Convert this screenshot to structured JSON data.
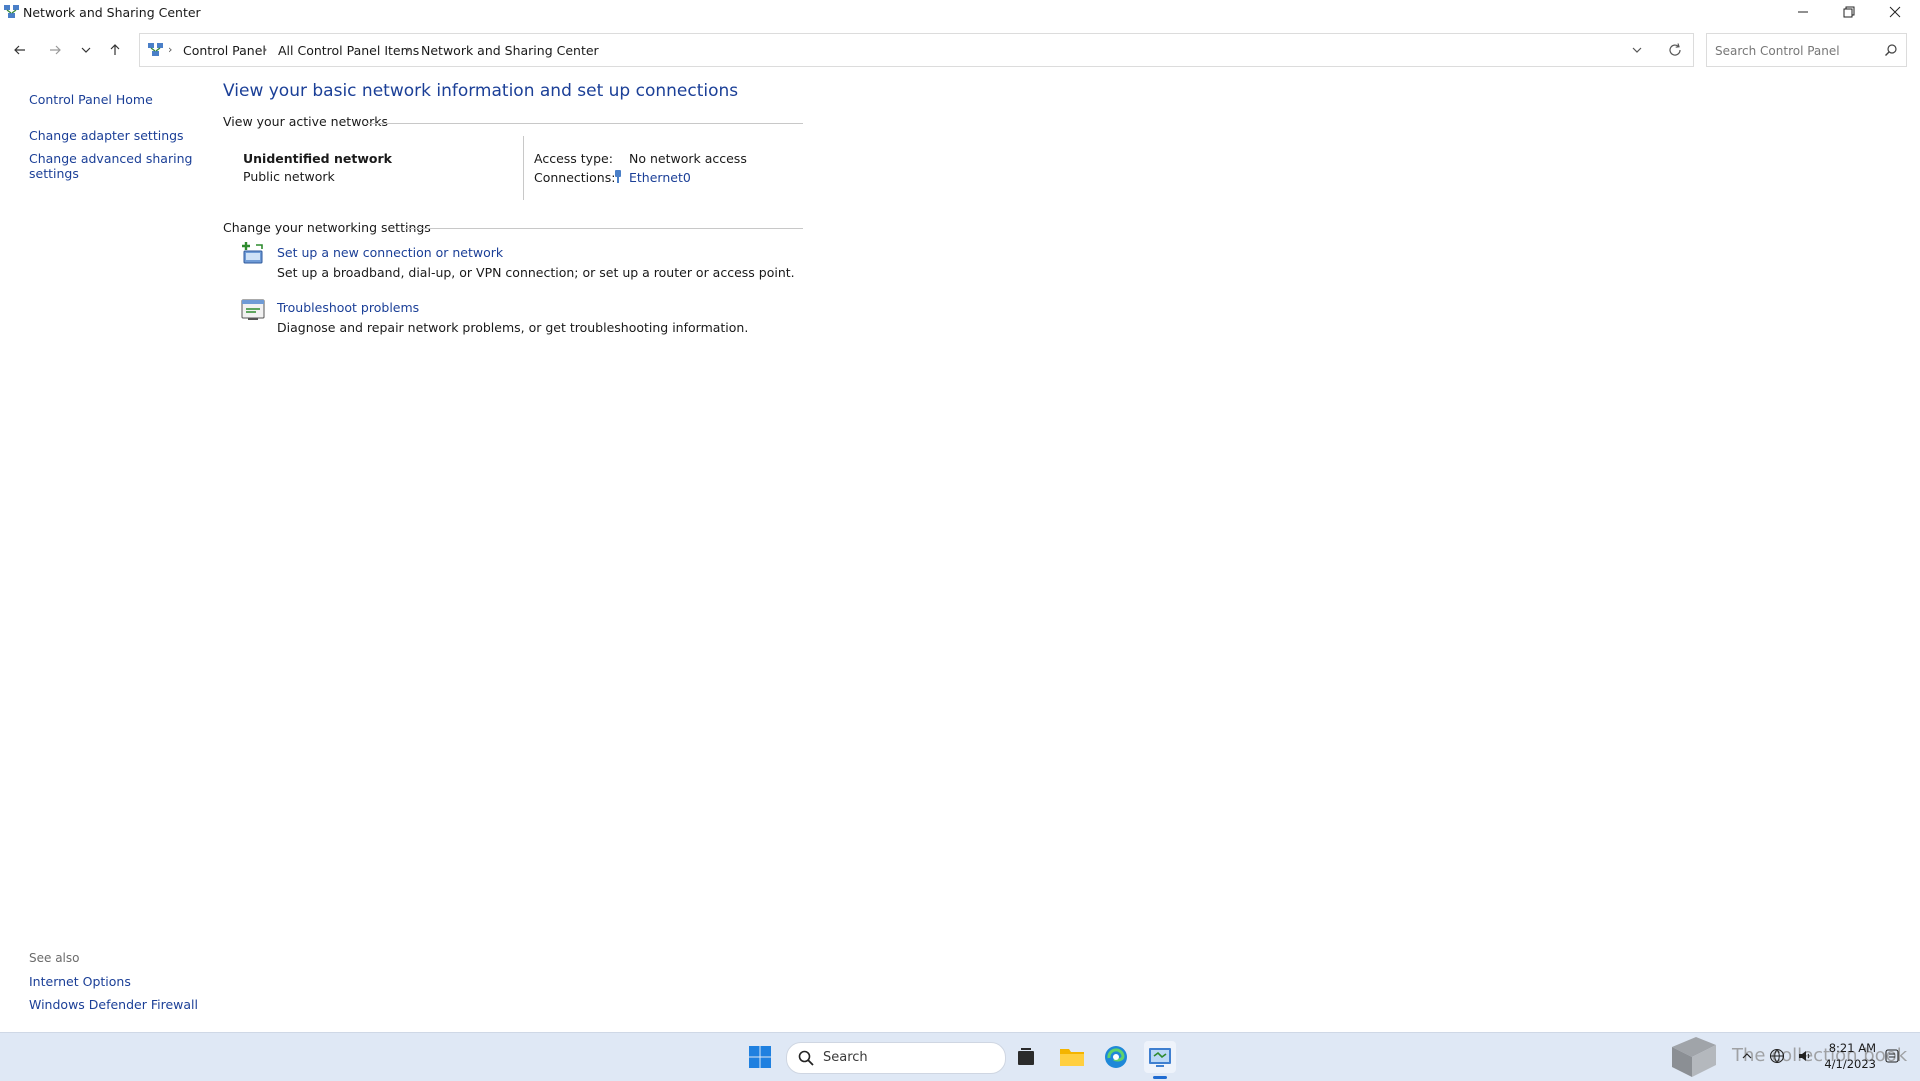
{
  "window": {
    "title": "Network and Sharing Center"
  },
  "address_bar": {
    "crumbs": [
      "Control Panel",
      "All Control Panel Items",
      "Network and Sharing Center"
    ]
  },
  "search": {
    "placeholder": "Search Control Panel"
  },
  "sidebar": {
    "home": "Control Panel Home",
    "adapter": "Change adapter settings",
    "advanced_line1": "Change advanced sharing",
    "advanced_line2": "settings",
    "see_also": "See also",
    "internet_options": "Internet Options",
    "firewall": "Windows Defender Firewall"
  },
  "main": {
    "title": "View your basic network information and set up connections",
    "active_networks_label": "View your active networks",
    "network_name": "Unidentified network",
    "network_profile": "Public network",
    "access_type_label": "Access type:",
    "access_type_value": "No network access",
    "connections_label": "Connections:",
    "connection_value": "Ethernet0",
    "change_settings_label": "Change your networking settings",
    "tasks": [
      {
        "link": "Set up a new connection or network",
        "desc": "Set up a broadband, dial-up, or VPN connection; or set up a router or access point."
      },
      {
        "link": "Troubleshoot problems",
        "desc": "Diagnose and repair network problems, or get troubleshooting information."
      }
    ]
  },
  "taskbar": {
    "search_label": "Search",
    "time": "8:21 AM",
    "date": "4/1/2023",
    "watermark": "The collection book"
  },
  "colors": {
    "link": "#1b3f97",
    "taskbar": "#dfe8f5",
    "accent": "#1f6bd1"
  }
}
